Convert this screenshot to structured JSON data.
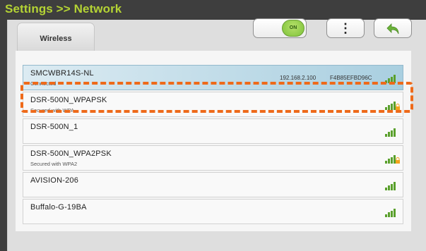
{
  "header": {
    "title": "Settings >> Network"
  },
  "tabs": [
    {
      "label": "Wireless"
    }
  ],
  "toolbar": {
    "toggle_label": "ON",
    "menu_glyph": "⋮",
    "toggle_icon": "toggle-switch",
    "menu_icon": "kebab-menu-icon",
    "back_icon": "back-arrow-icon"
  },
  "colors": {
    "title": "#b4d334",
    "highlight": "#ee6a1a",
    "signal": "#5aa02c",
    "lock": "#f2a31c"
  },
  "networks": [
    {
      "ssid": "SMCWBR14S-NL",
      "status": "Connected",
      "ip": "192.168.2.100",
      "mac": "F4B85EFBD96C",
      "secured": false,
      "selected": true
    },
    {
      "ssid": "DSR-500N_WPAPSK",
      "status": "Secured with WPA",
      "ip": "",
      "mac": "",
      "secured": true,
      "selected": false
    },
    {
      "ssid": "DSR-500N_1",
      "status": "",
      "ip": "",
      "mac": "",
      "secured": false,
      "selected": false
    },
    {
      "ssid": "DSR-500N_WPA2PSK",
      "status": "Secured with WPA2",
      "ip": "",
      "mac": "",
      "secured": true,
      "selected": false
    },
    {
      "ssid": "AVISION-206",
      "status": "",
      "ip": "",
      "mac": "",
      "secured": false,
      "selected": false
    },
    {
      "ssid": "Buffalo-G-19BA",
      "status": "",
      "ip": "",
      "mac": "",
      "secured": false,
      "selected": false
    }
  ]
}
